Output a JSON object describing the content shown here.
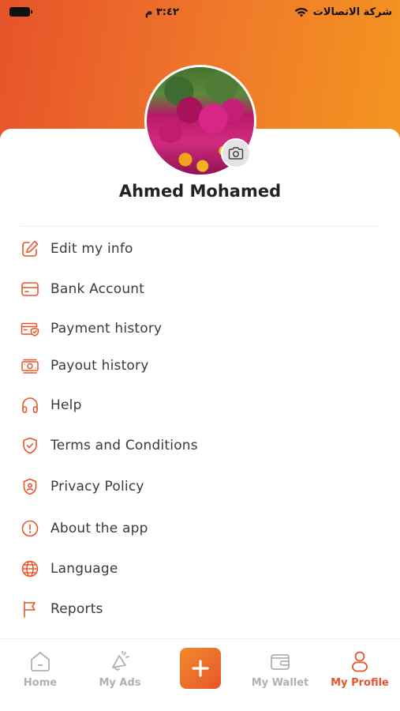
{
  "status_bar": {
    "time": "٣:٤٢ م",
    "carrier": "شركة الاتصالات"
  },
  "profile": {
    "name": "Ahmed Mohamed"
  },
  "menu": {
    "items": [
      {
        "label": "Edit my info",
        "icon": "edit-icon"
      },
      {
        "label": "Bank Account",
        "icon": "card-icon"
      },
      {
        "label": "Payment history",
        "icon": "payment-icon"
      },
      {
        "label": "Payout history",
        "icon": "payout-icon"
      },
      {
        "label": "Help",
        "icon": "headset-icon"
      },
      {
        "label": "Terms and Conditions",
        "icon": "shield-check-icon"
      },
      {
        "label": "Privacy Policy",
        "icon": "shield-user-icon"
      },
      {
        "label": "About the app",
        "icon": "info-icon"
      },
      {
        "label": "Language",
        "icon": "globe-icon"
      },
      {
        "label": "Reports",
        "icon": "flag-icon"
      }
    ]
  },
  "bottom_nav": {
    "home": "Home",
    "my_ads": "My Ads",
    "add": "+",
    "my_wallet": "My Wallet",
    "my_profile": "My Profile"
  },
  "colors": {
    "accent": "#e8552a",
    "gradient_start": "#e6532a",
    "gradient_end": "#f5951f",
    "inactive": "#b0b0b0"
  }
}
